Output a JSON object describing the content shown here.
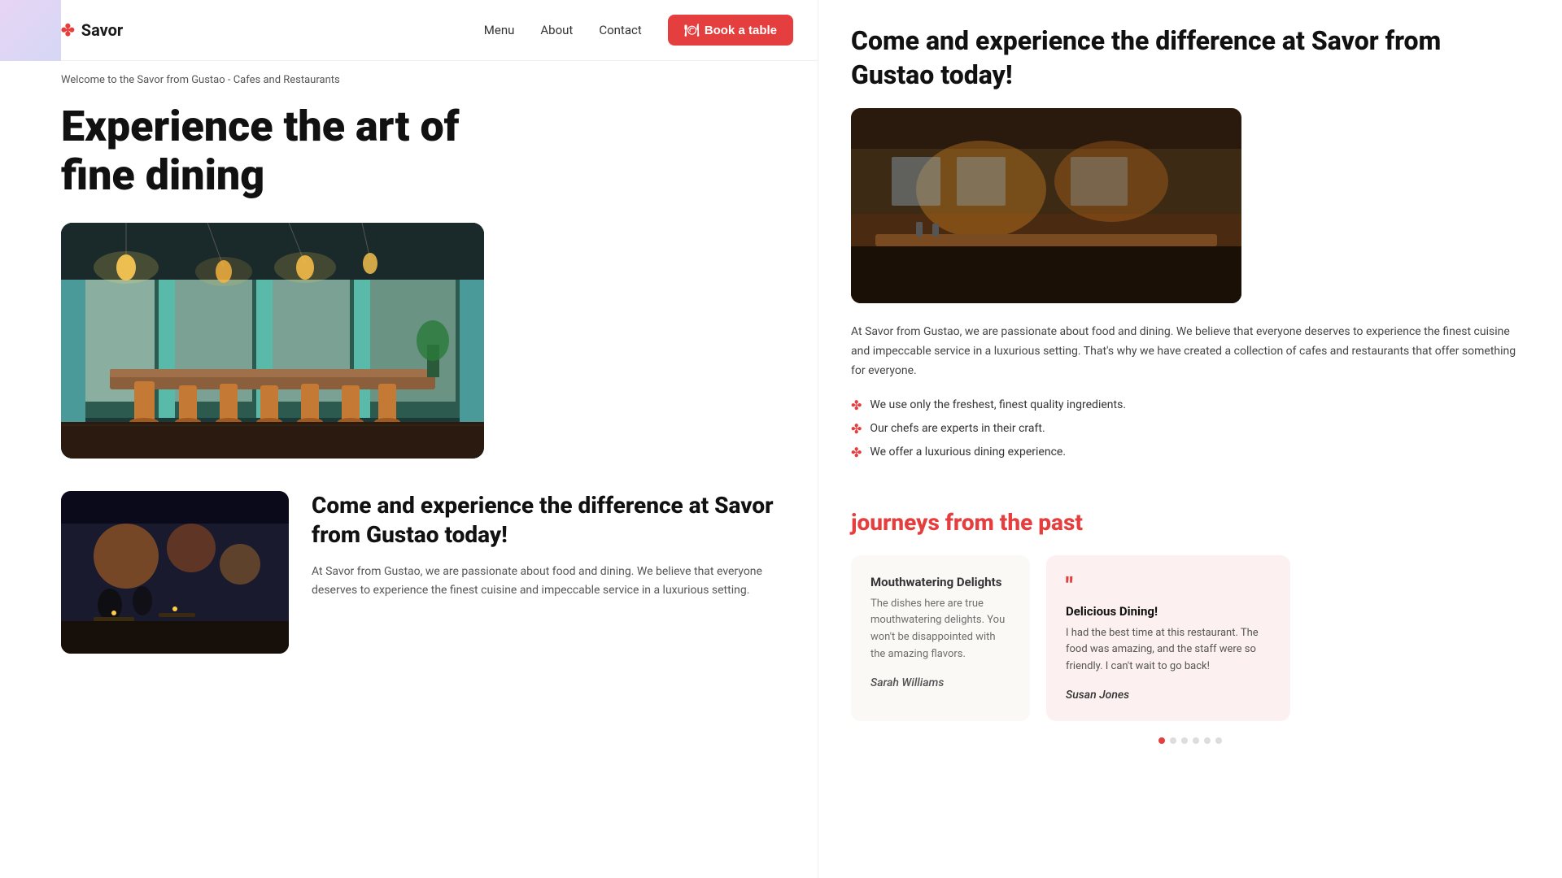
{
  "brand": {
    "name": "Savor",
    "logo_icon": "✤"
  },
  "nav": {
    "menu_label": "Menu",
    "about_label": "About",
    "contact_label": "Contact",
    "book_label": "Book a table",
    "book_icon": "🍽"
  },
  "breadcrumb": {
    "text": "Welcome to the Savor from Gustao - Cafes and Restaurants"
  },
  "hero": {
    "title_line1": "Experience the art of",
    "title_line2": "fine dining"
  },
  "right_panel": {
    "title": "Come and experience the difference at Savor from Gustao today!",
    "description": "At Savor from Gustao, we are passionate about food and dining. We believe that everyone deserves to experience the finest cuisine and impeccable service in a luxurious setting. That's why we have created a collection of cafes and restaurants that offer something for everyone.",
    "features": [
      "We use only the freshest, finest quality ingredients.",
      "Our chefs are experts in their craft.",
      "We offer a luxurious dining experience."
    ]
  },
  "bottom_section": {
    "title": "Come and experience the difference at Savor from Gustao today!",
    "description": "At Savor from Gustao, we are passionate about food and dining. We believe that everyone deserves to experience the finest cuisine and impeccable service in a luxurious setting."
  },
  "testimonials": {
    "section_title_pre": "journeys from the past",
    "cards": [
      {
        "title": "Mouthwatering Delights",
        "text": "The dishes here are true mouthwatering delights. You won't be disappointed with the amazing flavors.",
        "author": "Sarah Williams",
        "has_quote": false
      },
      {
        "title": "Delicious Dining!",
        "text": "I had the best time at this restaurant. The food was amazing, and the staff were so friendly. I can't wait to go back!",
        "author": "Susan Jones",
        "has_quote": true
      }
    ],
    "dots": [
      {
        "active": true
      },
      {
        "active": false
      },
      {
        "active": false
      },
      {
        "active": false
      },
      {
        "active": false
      },
      {
        "active": false
      }
    ]
  }
}
